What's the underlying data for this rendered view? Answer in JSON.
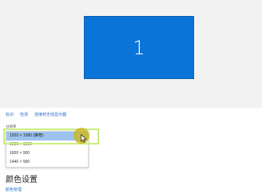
{
  "display": {
    "monitor_label": "1"
  },
  "links": {
    "identify": "标识",
    "detect": "检测",
    "connect_wireless": "连接到无线显示器"
  },
  "resolution": {
    "label": "分辨率",
    "options": [
      "1920 × 1080 (推荐)",
      "1680 × 1050",
      "1600 × 900",
      "1440 × 900"
    ],
    "selected_index": 0
  },
  "color_section": {
    "title": "颜色设置",
    "link": "颜色管理"
  },
  "colors": {
    "monitor_blue": "#0b74d8",
    "link_blue": "#2f6fc9",
    "selected_row": "#9dc3f0",
    "highlight_green": "#c8f07a",
    "cursor_yellow": "#cdb928"
  }
}
